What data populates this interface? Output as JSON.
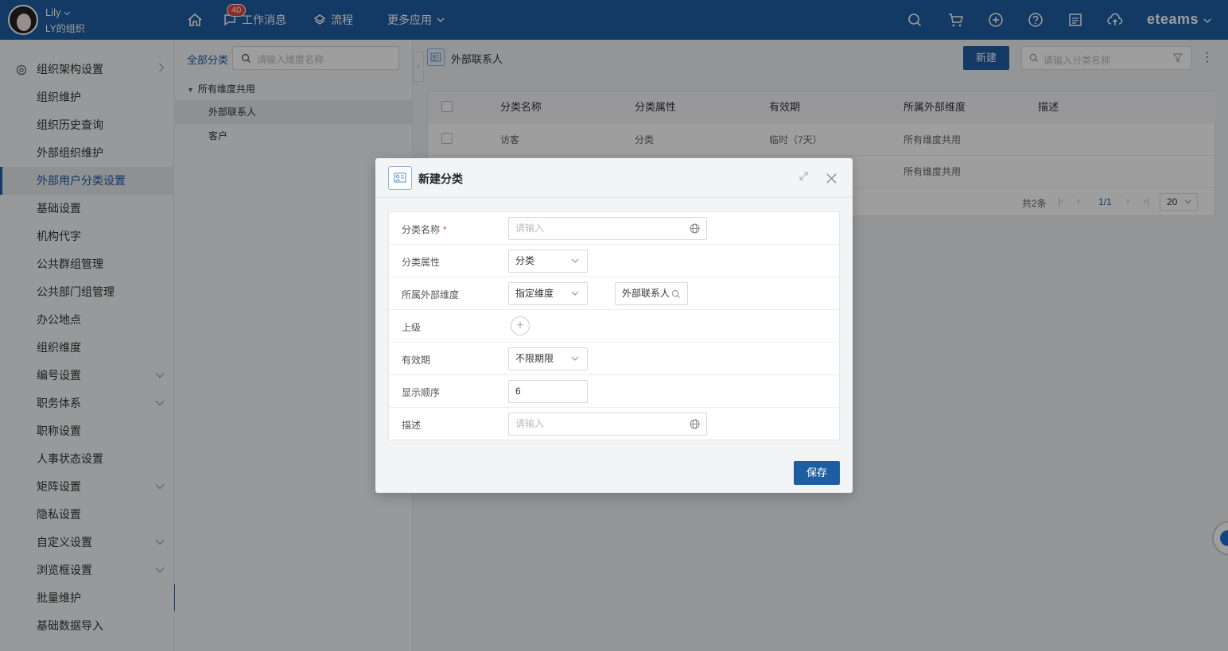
{
  "topbar": {
    "user_name": "Lily",
    "user_org": "LY的组织",
    "nav": {
      "messages_label": "工作消息",
      "messages_badge": "40",
      "flow_label": "流程",
      "more_label": "更多应用"
    },
    "brand": "eteams"
  },
  "sidebar": {
    "items": [
      {
        "label": "组织架构设置",
        "chevron": "right"
      },
      {
        "label": "组织维护"
      },
      {
        "label": "组织历史查询"
      },
      {
        "label": "外部组织维护"
      },
      {
        "label": "外部用户分类设置",
        "active": true
      },
      {
        "label": "基础设置"
      },
      {
        "label": "机构代字"
      },
      {
        "label": "公共群组管理"
      },
      {
        "label": "公共部门组管理"
      },
      {
        "label": "办公地点"
      },
      {
        "label": "组织维度"
      },
      {
        "label": "编号设置",
        "chevron": "down"
      },
      {
        "label": "职务体系",
        "chevron": "down"
      },
      {
        "label": "职称设置"
      },
      {
        "label": "人事状态设置"
      },
      {
        "label": "矩阵设置",
        "chevron": "down"
      },
      {
        "label": "隐私设置"
      },
      {
        "label": "自定义设置",
        "chevron": "down"
      },
      {
        "label": "浏览框设置",
        "chevron": "down"
      },
      {
        "label": "批量维护"
      },
      {
        "label": "基础数据导入"
      }
    ]
  },
  "tree": {
    "all_label": "全部分类",
    "search_placeholder": "请输入维度名称",
    "root_label": "所有维度共用",
    "nodes": [
      "外部联系人",
      "客户"
    ]
  },
  "main": {
    "title": "外部联系人",
    "new_button": "新建",
    "search_placeholder": "请输入分类名称",
    "table": {
      "headers": [
        "分类名称",
        "分类属性",
        "有效期",
        "所属外部维度",
        "描述"
      ],
      "rows": [
        [
          "访客",
          "分类",
          "临时（7天）",
          "所有维度共用",
          ""
        ],
        [
          "",
          "",
          "",
          "所有维度共用",
          ""
        ]
      ]
    },
    "pager": {
      "total": "共2条",
      "page": "1/1",
      "size": "20"
    }
  },
  "dialog": {
    "title": "新建分类",
    "fields": {
      "name_label": "分类名称",
      "name_required": "*",
      "name_placeholder": "请输入",
      "attr_label": "分类属性",
      "attr_value": "分类",
      "dim_label": "所属外部维度",
      "dim_select_value": "指定维度",
      "dim_browse_value": "外部联系人",
      "parent_label": "上级",
      "validity_label": "有效期",
      "validity_value": "不限期限",
      "order_label": "显示顺序",
      "order_value": "6",
      "desc_label": "描述",
      "desc_placeholder": "请输入"
    },
    "save_button": "保存"
  }
}
